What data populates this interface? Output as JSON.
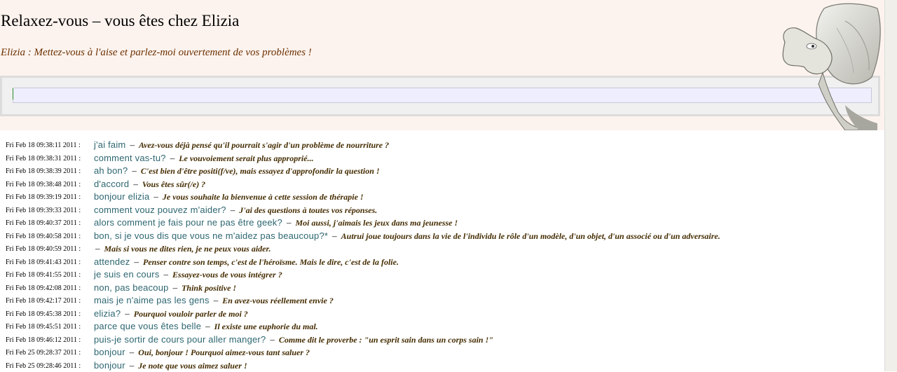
{
  "header": {
    "title": "Relaxez-vous – vous êtes chez Elizia",
    "subtitle": "Elizia : Mettez-vous à l'aise et parlez-moi ouvertement de vos problèmes !",
    "input_value": ""
  },
  "colors": {
    "header_bg": "#fdf3ee",
    "question": "#2d6670",
    "answer": "#442c00",
    "input_bg": "#eeeeff"
  },
  "log": [
    {
      "ts": "Fri Feb 18 09:38:11 2011 :",
      "q": "j'ai faim",
      "a": "Avez-vous déjà pensé qu'il pourrait s'agir d'un problème de nourriture ?"
    },
    {
      "ts": "Fri Feb 18 09:38:31 2011 :",
      "q": "comment vas-tu?",
      "a": "Le vouvoiement serait plus approprié..."
    },
    {
      "ts": "Fri Feb 18 09:38:39 2011 :",
      "q": "ah bon?",
      "a": "C'est bien d'être positi(f/ve), mais essayez d'approfondir la question !"
    },
    {
      "ts": "Fri Feb 18 09:38:48 2011 :",
      "q": "d'accord",
      "a": "Vous êtes sûr(/e) ?"
    },
    {
      "ts": "Fri Feb 18 09:39:19 2011 :",
      "q": "bonjour elizia",
      "a": "Je vous souhaite la bienvenue à cette session de thérapie !"
    },
    {
      "ts": "Fri Feb 18 09:39:33 2011 :",
      "q": "comment vouz pouvez m'aider?",
      "a": "J'ai des questions à toutes vos réponses."
    },
    {
      "ts": "Fri Feb 18 09:40:37 2011 :",
      "q": "alors comment je fais pour ne pas être geek?",
      "a": "Moi aussi, j'aimais les jeux dans ma jeunesse !"
    },
    {
      "ts": "Fri Feb 18 09:40:58 2011 :",
      "q": "bon, si je vous dis que vous ne m'aidez pas beaucoup?*",
      "a": "Autrui joue toujours dans la vie de l'individu le rôle d'un modèle, d'un objet, d'un associé ou d'un adversaire."
    },
    {
      "ts": "Fri Feb 18 09:40:59 2011 :",
      "q": "",
      "a": "Mais si vous ne dites rien, je ne peux vous aider."
    },
    {
      "ts": "Fri Feb 18 09:41:43 2011 :",
      "q": "attendez",
      "a": "Penser contre son temps, c'est de l'héroïsme. Mais le dire, c'est de la folie."
    },
    {
      "ts": "Fri Feb 18 09:41:55 2011 :",
      "q": "je suis en cours",
      "a": "Essayez-vous de vous intégrer ?"
    },
    {
      "ts": "Fri Feb 18 09:42:08 2011 :",
      "q": "non, pas beacoup",
      "a": "Think positive !"
    },
    {
      "ts": "Fri Feb 18 09:42:17 2011 :",
      "q": "mais je n'aime pas les gens",
      "a": "En avez-vous réellement envie ?"
    },
    {
      "ts": "Fri Feb 18 09:45:38 2011 :",
      "q": "elizia?",
      "a": "Pourquoi vouloir parler de moi ?"
    },
    {
      "ts": "Fri Feb 18 09:45:51 2011 :",
      "q": "parce que vous êtes belle",
      "a": "Il existe une euphorie du mal."
    },
    {
      "ts": "Fri Feb 18 09:46:12 2011 :",
      "q": "puis-je sortir de cours pour aller manger?",
      "a": "Comme dit le proverbe : \"un esprit sain dans un corps sain !\""
    },
    {
      "ts": "Fri Feb 25 09:28:37 2011 :",
      "q": "bonjour",
      "a": "Oui, bonjour ! Pourquoi aimez-vous tant saluer ?"
    },
    {
      "ts": "Fri Feb 25 09:28:46 2011 :",
      "q": "bonjour",
      "a": "Je note que vous aimez saluer !"
    }
  ]
}
